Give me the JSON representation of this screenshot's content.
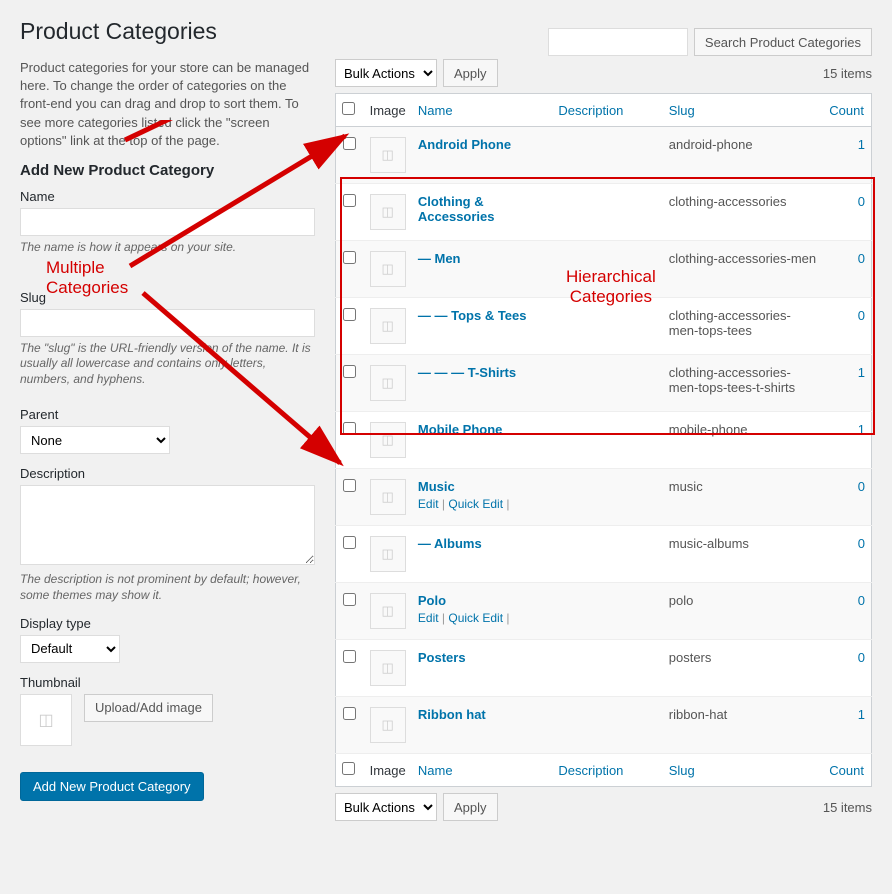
{
  "page_title": "Product Categories",
  "search": {
    "button": "Search Product Categories"
  },
  "intro": "Product categories for your store can be managed here. To change the order of categories on the front-end you can drag and drop to sort them. To see more categories listed click the \"screen options\" link at the top of the page.",
  "form": {
    "heading": "Add New Product Category",
    "name_label": "Name",
    "name_desc": "The name is how it appears on your site.",
    "slug_label": "Slug",
    "slug_desc": "The \"slug\" is the URL-friendly version of the name. It is usually all lowercase and contains only letters, numbers, and hyphens.",
    "parent_label": "Parent",
    "parent_value": "None",
    "description_label": "Description",
    "description_desc": "The description is not prominent by default; however, some themes may show it.",
    "display_type_label": "Display type",
    "display_type_value": "Default",
    "thumbnail_label": "Thumbnail",
    "upload_button": "Upload/Add image",
    "submit_button": "Add New Product Category"
  },
  "tablenav": {
    "bulk_label": "Bulk Actions",
    "apply_label": "Apply",
    "items_count": "15 items"
  },
  "columns": {
    "image": "Image",
    "name": "Name",
    "description": "Description",
    "slug": "Slug",
    "count": "Count"
  },
  "row_actions": {
    "edit": "Edit",
    "quick_edit": "Quick Edit",
    "sep": " | "
  },
  "rows": [
    {
      "name": "Android Phone",
      "slug": "android-phone",
      "count": "1",
      "show_actions": false
    },
    {
      "name": "Clothing & Accessories",
      "slug": "clothing-accessories",
      "count": "0",
      "show_actions": false
    },
    {
      "name": "— Men",
      "slug": "clothing-accessories-men",
      "count": "0",
      "show_actions": false
    },
    {
      "name": "— — Tops & Tees",
      "slug": "clothing-accessories-men-tops-tees",
      "count": "0",
      "show_actions": false
    },
    {
      "name": "— — — T-Shirts",
      "slug": "clothing-accessories-men-tops-tees-t-shirts",
      "count": "1",
      "show_actions": false
    },
    {
      "name": "Mobile Phone",
      "slug": "mobile-phone",
      "count": "1",
      "show_actions": false
    },
    {
      "name": "Music",
      "slug": "music",
      "count": "0",
      "show_actions": true
    },
    {
      "name": "— Albums",
      "slug": "music-albums",
      "count": "0",
      "show_actions": false
    },
    {
      "name": "Polo",
      "slug": "polo",
      "count": "0",
      "show_actions": true
    },
    {
      "name": "Posters",
      "slug": "posters",
      "count": "0",
      "show_actions": false
    },
    {
      "name": "Ribbon hat",
      "slug": "ribbon-hat",
      "count": "1",
      "show_actions": false
    }
  ],
  "annotations": {
    "multiple": "Multiple\nCategories",
    "hierarchical": "Hierarchical\nCategories"
  }
}
